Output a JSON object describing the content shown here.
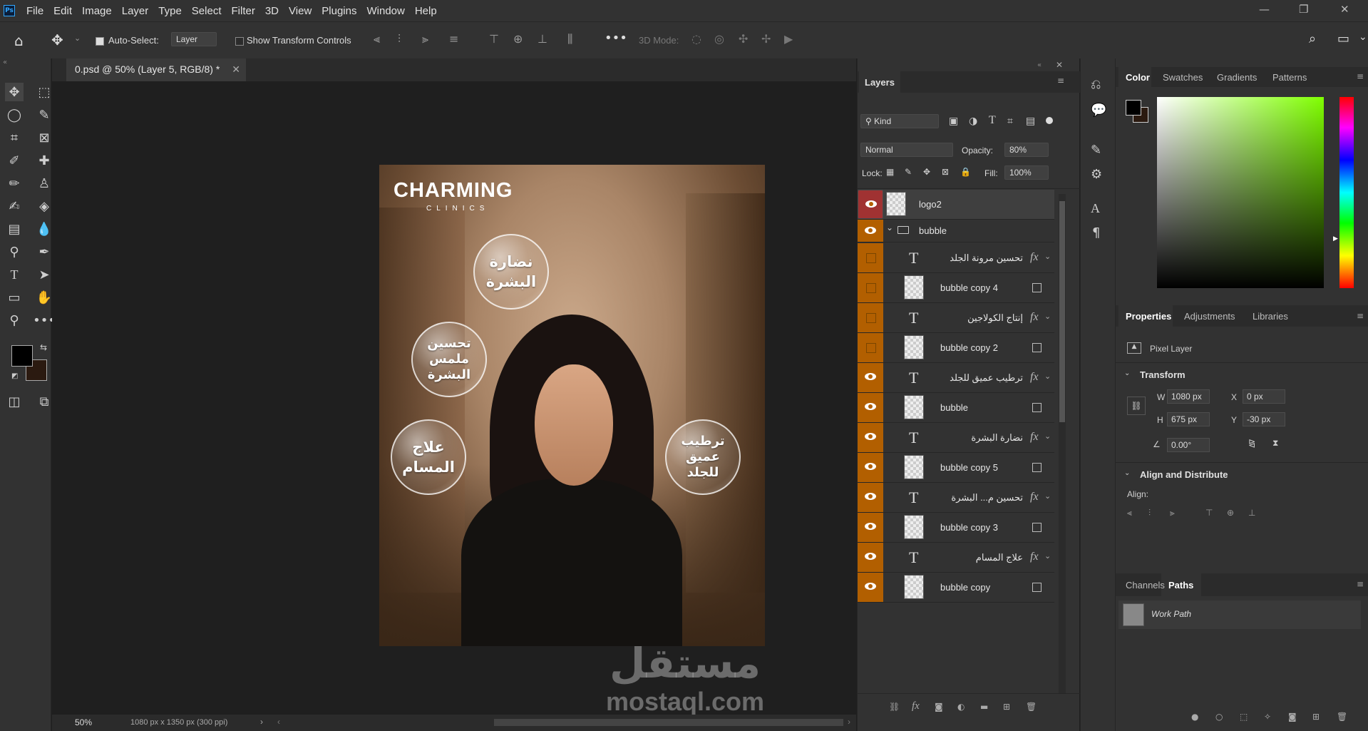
{
  "app": {
    "logo": "Ps"
  },
  "menu": [
    "File",
    "Edit",
    "Image",
    "Layer",
    "Type",
    "Select",
    "Filter",
    "3D",
    "View",
    "Plugins",
    "Window",
    "Help"
  ],
  "options": {
    "auto_select_label": "Auto-Select:",
    "auto_select_value": "Layer",
    "transform_label": "Show Transform Controls",
    "mode_3d_label": "3D Mode:"
  },
  "document": {
    "tab_title": "0.psd @ 50% (Layer 5, RGB/8) *",
    "zoom": "50%",
    "info": "1080 px x 1350 px (300 ppi)"
  },
  "artwork": {
    "brand": "CHARMING",
    "brand_sub": "CLINICS",
    "bubble_1": "نضارة البشرة",
    "bubble_2": "تحسين ملمس البشرة",
    "bubble_3": "علاج المسام",
    "bubble_4": "ترطيب عميق للجلد",
    "watermark_ar": "مستقل",
    "watermark_en": "mostaql.com"
  },
  "layers_panel": {
    "title": "Layers",
    "filter_kind": "Kind",
    "blend_mode": "Normal",
    "opacity_label": "Opacity:",
    "opacity_value": "80%",
    "lock_label": "Lock:",
    "fill_label": "Fill:",
    "fill_value": "100%",
    "layers": [
      {
        "name": "logo2",
        "type": "pixel",
        "visible": true,
        "selected": true
      },
      {
        "name": "bubble",
        "type": "group",
        "visible": true
      },
      {
        "name": "تحسين مرونة الجلد",
        "type": "text",
        "visible": false
      },
      {
        "name": "bubble copy 4",
        "type": "smart",
        "visible": false
      },
      {
        "name": "إنتاج الكولاجين",
        "type": "text",
        "visible": false
      },
      {
        "name": "bubble copy 2",
        "type": "smart",
        "visible": false
      },
      {
        "name": "ترطيب عميق للجلد",
        "type": "text",
        "visible": true
      },
      {
        "name": "bubble",
        "type": "smart",
        "visible": true
      },
      {
        "name": "نضارة البشرة",
        "type": "text",
        "visible": true
      },
      {
        "name": "bubble copy 5",
        "type": "smart",
        "visible": true
      },
      {
        "name": "تحسين م... البشرة",
        "type": "text",
        "visible": true
      },
      {
        "name": "bubble copy 3",
        "type": "smart",
        "visible": true
      },
      {
        "name": "علاج المسام",
        "type": "text",
        "visible": true
      },
      {
        "name": "bubble copy",
        "type": "smart",
        "visible": true
      }
    ]
  },
  "color_panel": {
    "tabs": [
      "Color",
      "Swatches",
      "Gradients",
      "Patterns"
    ],
    "active_tab": "Color",
    "foreground": "#000000",
    "background": "#2b1a10",
    "hue_color": "#7fff00"
  },
  "properties_panel": {
    "tabs": [
      "Properties",
      "Adjustments",
      "Libraries"
    ],
    "layer_kind": "Pixel Layer",
    "transform_title": "Transform",
    "w_label": "W",
    "w": "1080 px",
    "h_label": "H",
    "h": "675 px",
    "x_label": "X",
    "x": "0 px",
    "y_label": "Y",
    "y": "-30 px",
    "angle": "0.00°",
    "align_title": "Align and Distribute",
    "align_label": "Align:"
  },
  "paths_panel": {
    "tabs": [
      "Channels",
      "Paths"
    ],
    "active_tab": "Paths",
    "items": [
      "Work Path"
    ]
  }
}
